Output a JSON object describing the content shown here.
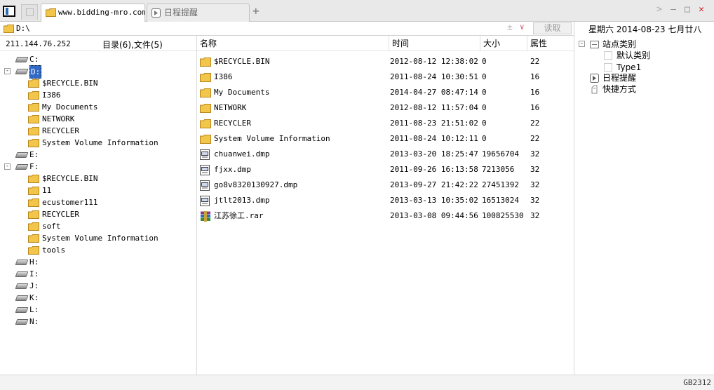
{
  "tabs": [
    {
      "label": "www.bidding-mro.com",
      "icon": "folder-icon",
      "active": true
    },
    {
      "label": "日程提醒",
      "icon": "schedule-icon",
      "active": false
    }
  ],
  "tab_add_label": "+",
  "window_controls": {
    "forward": ">",
    "minimize": "—",
    "maximize": "□",
    "close": "✕",
    "close_color": "#d21d1d"
  },
  "address": {
    "path": "D:\\",
    "plus": "±",
    "dropdown": "∨",
    "read_button": "读取"
  },
  "date_text": "星期六 2014-08-23 七月廿八",
  "left": {
    "ip": "211.144.76.252",
    "counts": "目录(6),文件(5)",
    "tree": [
      {
        "type": "drive",
        "label": "C:",
        "level": 0,
        "expand": ""
      },
      {
        "type": "drive",
        "label": "D:",
        "level": 0,
        "expand": "-",
        "selected": true
      },
      {
        "type": "folder",
        "label": "$RECYCLE.BIN",
        "level": 1
      },
      {
        "type": "folder",
        "label": "I386",
        "level": 1
      },
      {
        "type": "folder",
        "label": "My Documents",
        "level": 1
      },
      {
        "type": "folder",
        "label": "NETWORK",
        "level": 1
      },
      {
        "type": "folder",
        "label": "RECYCLER",
        "level": 1
      },
      {
        "type": "folder",
        "label": "System Volume Information",
        "level": 1
      },
      {
        "type": "drive",
        "label": "E:",
        "level": 0,
        "expand": ""
      },
      {
        "type": "drive",
        "label": "F:",
        "level": 0,
        "expand": "-"
      },
      {
        "type": "folder",
        "label": "$RECYCLE.BIN",
        "level": 1
      },
      {
        "type": "folder",
        "label": "11",
        "level": 1
      },
      {
        "type": "folder",
        "label": "ecustomer111",
        "level": 1
      },
      {
        "type": "folder",
        "label": "RECYCLER",
        "level": 1
      },
      {
        "type": "folder",
        "label": "soft",
        "level": 1
      },
      {
        "type": "folder",
        "label": "System Volume Information",
        "level": 1
      },
      {
        "type": "folder",
        "label": "tools",
        "level": 1
      },
      {
        "type": "drive",
        "label": "H:",
        "level": 0,
        "expand": ""
      },
      {
        "type": "drive",
        "label": "I:",
        "level": 0,
        "expand": ""
      },
      {
        "type": "drive",
        "label": "J:",
        "level": 0,
        "expand": ""
      },
      {
        "type": "drive",
        "label": "K:",
        "level": 0,
        "expand": ""
      },
      {
        "type": "drive",
        "label": "L:",
        "level": 0,
        "expand": ""
      },
      {
        "type": "drive",
        "label": "N:",
        "level": 0,
        "expand": ""
      }
    ]
  },
  "list": {
    "headers": {
      "name": "名称",
      "time": "时间",
      "size": "大小",
      "attr": "属性"
    },
    "rows": [
      {
        "icon": "folder",
        "name": "$RECYCLE.BIN",
        "time": "2012-08-12 12:38:02",
        "size": "0",
        "attr": "22"
      },
      {
        "icon": "folder",
        "name": "I386",
        "time": "2011-08-24 10:30:51",
        "size": "0",
        "attr": "16"
      },
      {
        "icon": "folder",
        "name": "My Documents",
        "time": "2014-04-27 08:47:14",
        "size": "0",
        "attr": "16"
      },
      {
        "icon": "folder",
        "name": "NETWORK",
        "time": "2012-08-12 11:57:04",
        "size": "0",
        "attr": "16"
      },
      {
        "icon": "folder",
        "name": "RECYCLER",
        "time": "2011-08-23 21:51:02",
        "size": "0",
        "attr": "22"
      },
      {
        "icon": "folder",
        "name": "System Volume Information",
        "time": "2011-08-24 10:12:11",
        "size": "0",
        "attr": "22"
      },
      {
        "icon": "dmp",
        "name": "chuanwei.dmp",
        "time": "2013-03-20 18:25:47",
        "size": "19656704",
        "attr": "32"
      },
      {
        "icon": "dmp",
        "name": "fjxx.dmp",
        "time": "2011-09-26 16:13:58",
        "size": "7213056",
        "attr": "32"
      },
      {
        "icon": "dmp",
        "name": "go8v8320130927.dmp",
        "time": "2013-09-27 21:42:22",
        "size": "27451392",
        "attr": "32"
      },
      {
        "icon": "dmp",
        "name": "jtlt2013.dmp",
        "time": "2013-03-13 10:35:02",
        "size": "16513024",
        "attr": "32"
      },
      {
        "icon": "rar",
        "name": "江苏徐工.rar",
        "time": "2013-03-08 09:44:56",
        "size": "100825530",
        "attr": "32"
      }
    ]
  },
  "right_tree": [
    {
      "label": "站点类别",
      "level": 0,
      "expand": "-",
      "icon": "category-icon"
    },
    {
      "label": "默认类别",
      "level": 1,
      "icon": "item-icon"
    },
    {
      "label": "Type1",
      "level": 1,
      "icon": "item-icon"
    },
    {
      "label": "日程提醒",
      "level": 0,
      "icon": "schedule-icon"
    },
    {
      "label": "快捷方式",
      "level": 0,
      "icon": "shortcut-icon"
    }
  ],
  "status": {
    "encoding": "GB2312"
  },
  "colors": {
    "selection": "#3169c6",
    "folder": "#f2c54b",
    "close": "#d21d1d"
  }
}
